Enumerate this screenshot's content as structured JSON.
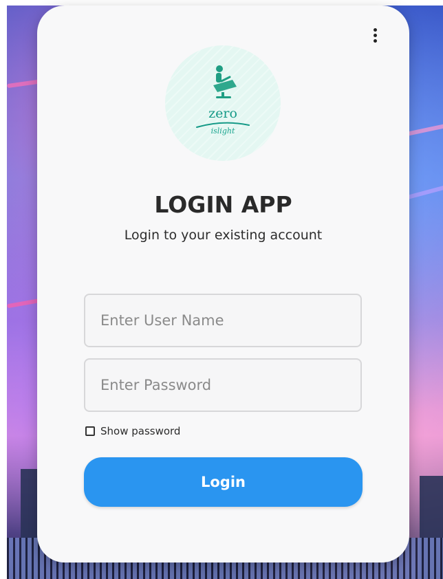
{
  "logo": {
    "icon": "dental-chair-icon",
    "name": "zero",
    "tagline": "islight",
    "color": "#159a87"
  },
  "header": {
    "title": "LOGIN APP",
    "subtitle": "Login to your existing account"
  },
  "form": {
    "username": {
      "placeholder": "Enter User Name",
      "value": ""
    },
    "password": {
      "placeholder": "Enter Password",
      "value": ""
    },
    "show_password": {
      "label": "Show password",
      "checked": false
    },
    "submit_label": "Login"
  },
  "menu": {
    "icon": "more-vertical-icon"
  },
  "colors": {
    "accent": "#2a95f0",
    "card_background": "#f8f8f9",
    "logo_circle": "#e4f7f2"
  }
}
